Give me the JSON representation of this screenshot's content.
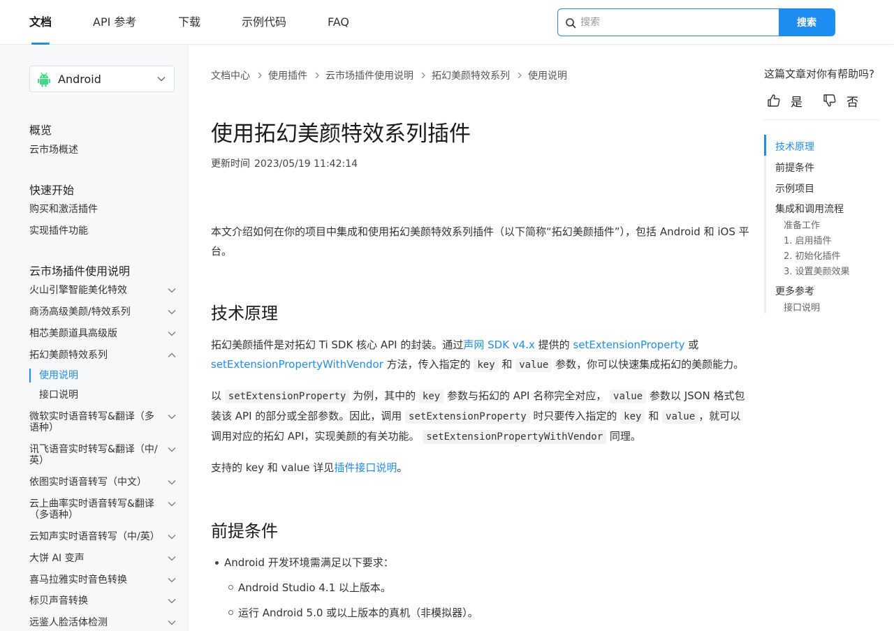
{
  "topnav": {
    "tabs": [
      {
        "label": "文档",
        "active": true
      },
      {
        "label": "API 参考",
        "active": false
      },
      {
        "label": "下载",
        "active": false
      },
      {
        "label": "示例代码",
        "active": false
      },
      {
        "label": "FAQ",
        "active": false
      }
    ],
    "search": {
      "placeholder": "搜索",
      "button_label": "搜索"
    }
  },
  "sidebar": {
    "platform": {
      "label": "Android",
      "icon": "android-icon"
    },
    "sections": [
      {
        "heading": "概览",
        "items": [
          "云市场概述"
        ]
      },
      {
        "heading": "快速开始",
        "items": [
          "购买和激活插件",
          "实现插件功能"
        ]
      },
      {
        "heading": "云市场插件使用说明"
      }
    ],
    "plugins": [
      {
        "label": "火山引擎智能美化特效",
        "expanded": false
      },
      {
        "label": "商汤高级美颜/特效系列",
        "expanded": false
      },
      {
        "label": "相芯美颜道具高级版",
        "expanded": false
      },
      {
        "label": "拓幻美颜特效系列",
        "expanded": true
      },
      {
        "label": "微软实时语音转写&翻译（多语种）",
        "expanded": false
      },
      {
        "label": "讯飞语音实时转写&翻译（中/英）",
        "expanded": false
      },
      {
        "label": "依图实时语音转写（中文）",
        "expanded": false
      },
      {
        "label": "云上曲率实时语音转写&翻译（多语种）",
        "expanded": false
      },
      {
        "label": "云知声实时语音转写（中/英）",
        "expanded": false
      },
      {
        "label": "大饼 AI 变声",
        "expanded": false
      },
      {
        "label": "喜马拉雅实时音色转换",
        "expanded": false
      },
      {
        "label": "标贝声音转换",
        "expanded": false
      },
      {
        "label": "远鉴人脸活体检测",
        "expanded": false
      }
    ],
    "sub_items": [
      {
        "label": "使用说明",
        "active": true
      },
      {
        "label": "接口说明",
        "active": false
      }
    ]
  },
  "main": {
    "breadcrumb": [
      "文档中心",
      "使用插件",
      "云市场插件使用说明",
      "拓幻美颜特效系列",
      "使用说明"
    ],
    "title": "使用拓幻美颜特效系列插件",
    "update_label": "更新时间",
    "update_time": "2023/05/19 11:42:14",
    "intro": "本文介绍如何在你的项目中集成和使用拓幻美颜特效系列插件（以下简称“拓幻美颜插件”），包括 Android 和 iOS 平台。",
    "section1": {
      "heading": "技术原理",
      "p1": {
        "t1": "拓幻美颜插件是对拓幻 Ti SDK 核心 API 的封装。通过",
        "link1": "声网 SDK v4.x",
        "t2": " 提供的 ",
        "link2": "setExtensionProperty",
        "t3": " 或 ",
        "link3": "setExtensionPropertyWithVendor",
        "t4": " 方法，传入指定的 ",
        "code1": "key",
        "t5": " 和 ",
        "code2": "value",
        "t6": " 参数，你可以快速集成拓幻的美颜能力。"
      },
      "p2": {
        "t1": "以 ",
        "code1": "setExtensionProperty",
        "t2": " 为例，其中的 ",
        "code2": "key",
        "t3": " 参数与拓幻的 API 名称完全对应， ",
        "code3": "value",
        "t4": " 参数以 JSON 格式包装该 API 的部分或全部参数。因此，调用 ",
        "code4": "setExtensionProperty",
        "t5": " 时只要传入指定的 ",
        "code5": "key",
        "t6": " 和 ",
        "code6": "value",
        "t7": "，就可以调用对应的拓幻 API，实现美颜的有关功能。 ",
        "code7": "setExtensionPropertyWithVendor",
        "t8": " 同理。"
      },
      "p3": {
        "t1": "支持的 key 和 value 详见",
        "link1": "插件接口说明",
        "t2": "。"
      }
    },
    "section2": {
      "heading": "前提条件",
      "bullet1": "Android 开发环境需满足以下要求：",
      "sub1": "Android Studio 4.1 以上版本。",
      "sub2": "运行 Android 5.0 或以上版本的真机（非模拟器）。"
    }
  },
  "toc": {
    "helpful_question": "这篇文章对你有帮助吗?",
    "yes_label": "是",
    "no_label": "否",
    "items": [
      {
        "label": "技术原理",
        "active": true
      },
      {
        "label": "前提条件",
        "active": false
      },
      {
        "label": "示例项目",
        "active": false
      },
      {
        "label": "集成和调用流程",
        "active": false
      },
      {
        "label": "准备工作",
        "sub": true
      },
      {
        "label": "1. 启用插件",
        "sub": true
      },
      {
        "label": "2. 初始化插件",
        "sub": true
      },
      {
        "label": "3. 设置美颜效果",
        "sub": true
      },
      {
        "label": "更多参考",
        "active": false
      },
      {
        "label": "接口说明",
        "sub": true
      }
    ]
  },
  "colors": {
    "accent": "#1e8cf0",
    "android_green": "#3ddc84"
  }
}
